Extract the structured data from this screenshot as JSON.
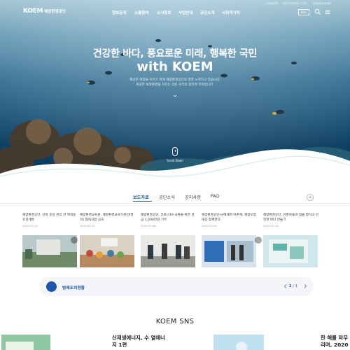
{
  "header": {
    "logo_mark": "KOEM",
    "logo_name": "해양환경공단",
    "top_links": [
      "(구)통합하위",
      "국민권익위원회(구)위원",
      "해양환경교육센터"
    ],
    "menu": [
      "정보공개",
      "소통참여",
      "소식정보",
      "사업안내",
      "공단소개",
      "사회적가치"
    ],
    "lang_button": "ENG",
    "icons": [
      "search-icon",
      "menu-icon"
    ]
  },
  "hero": {
    "title_line1": "건강한 바다, 풍요로운 미래, 행복한 국민",
    "title_line2": "with KOEM",
    "desc_line1": "깨끗한 해양을 지키기 위해 해양환경공단의 경영 노력하고 있습니다.",
    "desc_line2": "깨끗한 해양환경을 지키는 것은 우리의 몫이며 약속입니다.",
    "scroll_label": "Scroll Down"
  },
  "tabs": {
    "items": [
      "보도자료",
      "공단소식",
      "공지사항",
      "FAQ"
    ],
    "active": "보도자료",
    "more_label": "+"
  },
  "news": [
    {
      "text": "해양환경공단, 선박 운용 관리 관 혁적용 유성개발",
      "date": "2020.03.13"
    },
    {
      "text": "해양환경교육원, 해양환경교육기관(비영리) 협력사업 공모",
      "date": "2020.03.10"
    },
    {
      "text": "해양환경공단, 코로나19 극복을 위한 성금 1,000만원 기부",
      "date": "2020.03.06"
    },
    {
      "text": "해양환경공단-남해해역 어촌계, 해양오염 대응 함께한다",
      "date": "2020.03.05"
    },
    {
      "text": "해양환경공단, 어촌마을과 힘을 합하고 안전한 바다 만들기",
      "date": "2020.02.28"
    }
  ],
  "penalty": {
    "label": "방제조치현황",
    "current_page": "2",
    "separator": "/",
    "total_pages": "1"
  },
  "sns": {
    "title": "KOEM SNS",
    "cards": [
      {
        "text": "신재생에너지, 수 열에너지 1편"
      },
      {
        "text": "한 해를 마무 리며, 2020"
      }
    ]
  },
  "colors": {
    "brand": "#1a57a6",
    "sea_deep": "#0b3552",
    "sea_light": "#8fb6c8"
  }
}
